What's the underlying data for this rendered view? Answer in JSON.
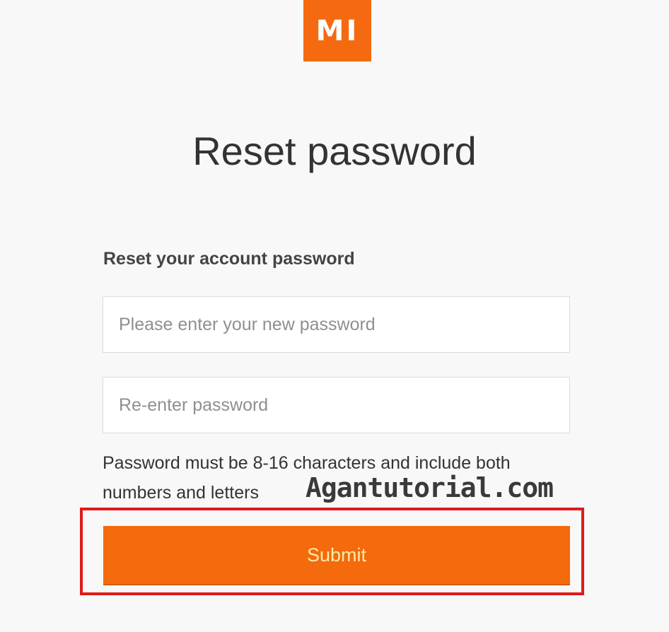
{
  "brand": {
    "logo_text": "MI",
    "logo_color": "#f56a10"
  },
  "title": "Reset password",
  "form": {
    "heading": "Reset your account password",
    "new_password": {
      "value": "",
      "placeholder": "Please enter your new password"
    },
    "confirm_password": {
      "value": "",
      "placeholder": "Re-enter password"
    },
    "hint": "Password must be 8-16 characters and include both numbers and letters",
    "submit_label": "Submit",
    "submit_color": "#f46a0c"
  },
  "watermark": "Agantutorial.com",
  "highlight_color": "#e01a1a"
}
